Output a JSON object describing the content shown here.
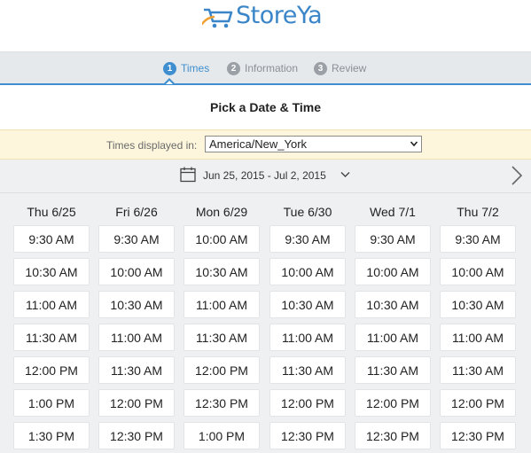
{
  "logo": {
    "text": "StoreYa"
  },
  "steps": [
    {
      "num": "1",
      "label": "Times"
    },
    {
      "num": "2",
      "label": "Information"
    },
    {
      "num": "3",
      "label": "Review"
    }
  ],
  "page_title": "Pick a Date & Time",
  "timezone": {
    "label": "Times displayed in:",
    "value": "America/New_York"
  },
  "date_range": "Jun 25, 2015 - Jul 2, 2015",
  "days": [
    {
      "head": "Thu 6/25",
      "slots": [
        "9:30 AM",
        "10:30 AM",
        "11:00 AM",
        "11:30 AM",
        "12:00 PM",
        "1:00 PM",
        "1:30 PM"
      ]
    },
    {
      "head": "Fri 6/26",
      "slots": [
        "9:30 AM",
        "10:00 AM",
        "10:30 AM",
        "11:00 AM",
        "11:30 AM",
        "12:00 PM",
        "12:30 PM"
      ]
    },
    {
      "head": "Mon 6/29",
      "slots": [
        "10:00 AM",
        "10:30 AM",
        "11:00 AM",
        "11:30 AM",
        "12:00 PM",
        "12:30 PM",
        "1:00 PM"
      ]
    },
    {
      "head": "Tue 6/30",
      "slots": [
        "9:30 AM",
        "10:00 AM",
        "10:30 AM",
        "11:00 AM",
        "11:30 AM",
        "12:00 PM",
        "12:30 PM"
      ]
    },
    {
      "head": "Wed 7/1",
      "slots": [
        "9:30 AM",
        "10:00 AM",
        "10:30 AM",
        "11:00 AM",
        "11:30 AM",
        "12:00 PM",
        "12:30 PM"
      ]
    },
    {
      "head": "Thu 7/2",
      "slots": [
        "9:30 AM",
        "10:00 AM",
        "10:30 AM",
        "11:00 AM",
        "11:30 AM",
        "12:00 PM",
        "12:30 PM"
      ]
    }
  ],
  "colors": {
    "accent": "#3f8fd0",
    "logo_blue": "#3a86c8",
    "logo_orange": "#f0a030",
    "tz_bg": "#fdf6dc"
  },
  "icons": {
    "cart": "shopping-cart-icon",
    "calendar": "calendar-icon",
    "chevron": "chevron-down-icon",
    "next": "chevron-right-icon"
  }
}
